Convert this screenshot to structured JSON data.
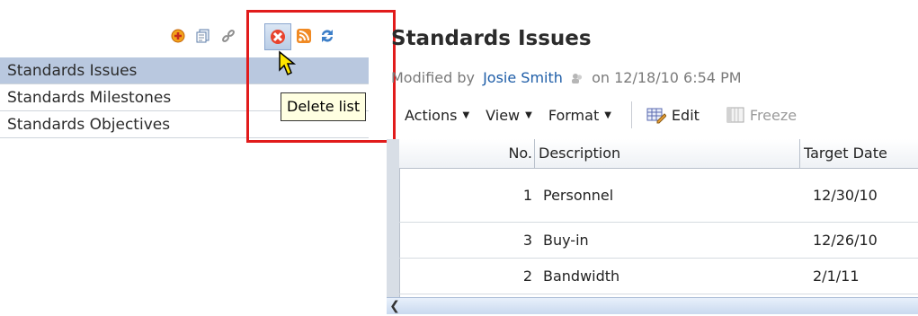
{
  "toolbar": {
    "icons": [
      "add-list-icon",
      "copy-list-icon",
      "link-list-icon",
      "delete-list-icon",
      "rss-feed-icon",
      "refresh-icon"
    ],
    "tooltip": "Delete list"
  },
  "lists": {
    "items": [
      {
        "label": "Standards Issues",
        "selected": true
      },
      {
        "label": "Standards Milestones",
        "selected": false
      },
      {
        "label": "Standards Objectives",
        "selected": false
      }
    ]
  },
  "main": {
    "title": "Standards Issues",
    "modified_prefix": "Modified by",
    "modified_user": "Josie Smith",
    "modified_on": "on 12/18/10 6:54 PM",
    "menus": [
      "Actions",
      "View",
      "Format"
    ],
    "edit_label": "Edit",
    "freeze_label": "Freeze"
  },
  "table": {
    "headers": {
      "no": "No.",
      "description": "Description",
      "target_date": "Target Date"
    },
    "rows": [
      {
        "no": "1",
        "description": "Personnel",
        "target_date": "12/30/10"
      },
      {
        "no": "3",
        "description": "Buy-in",
        "target_date": "12/26/10"
      },
      {
        "no": "2",
        "description": "Bandwidth",
        "target_date": "2/1/11"
      }
    ]
  },
  "colors": {
    "highlight_box": "#e11b1b",
    "selected_row": "#b9c8df",
    "link": "#1f5ea8",
    "tooltip_bg": "#ffffe1"
  }
}
